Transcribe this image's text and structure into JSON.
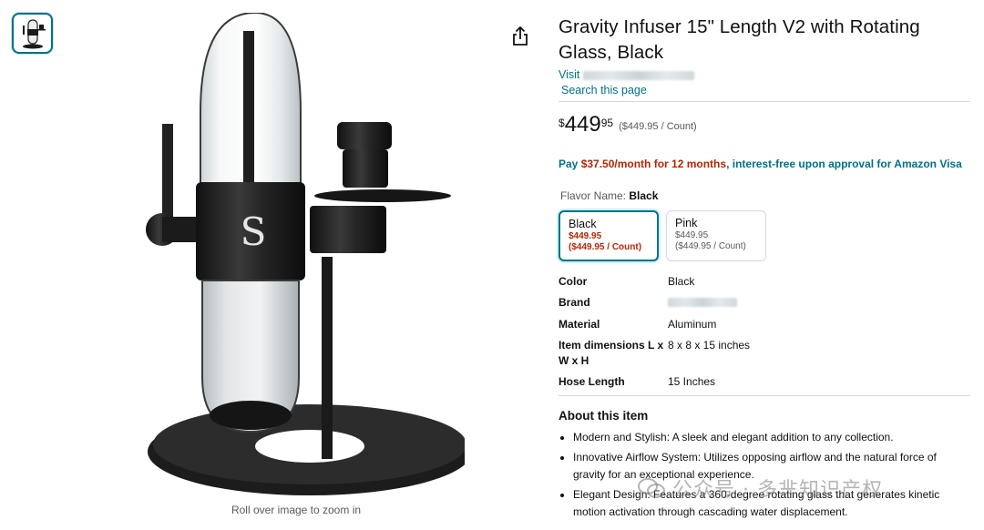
{
  "gallery": {
    "zoom_hint": "Roll over image to zoom in"
  },
  "product": {
    "title": "Gravity Infuser 15\" Length V2 with Rotating Glass, Black",
    "visit_prefix": "Visit",
    "search_page": "Search this page",
    "price": {
      "symbol": "$",
      "whole": "449",
      "fraction": "95",
      "per_unit": "($449.95 / Count)"
    },
    "financing": {
      "prefix": "Pay ",
      "amount": "$37.50/month for 12 months",
      "suffix": ", interest-free upon approval for Amazon Visa"
    },
    "flavor": {
      "label": "Flavor Name: ",
      "selected": "Black",
      "options": [
        {
          "name": "Black",
          "price": "$449.95",
          "unit": "($449.95 / Count)"
        },
        {
          "name": "Pink",
          "price": "$449.95",
          "unit": "($449.95 / Count)"
        }
      ]
    },
    "specs": [
      {
        "key": "Color",
        "value": "Black"
      },
      {
        "key": "Brand",
        "value": ""
      },
      {
        "key": "Material",
        "value": "Aluminum"
      },
      {
        "key": "Item dimensions L x W x H",
        "value": "8 x 8 x 15 inches"
      },
      {
        "key": "Hose Length",
        "value": "15 Inches"
      }
    ],
    "about_title": "About this item",
    "bullets": [
      "Modern and Stylish: A sleek and elegant addition to any collection.",
      "Innovative Airflow System: Utilizes opposing airflow and the natural force of gravity for an exceptional experience.",
      "Elegant Design: Features a 360-degree rotating glass that generates kinetic motion activation through cascading water displacement."
    ]
  },
  "watermark": {
    "text": "公众号 · 多芈知识产权"
  },
  "colors": {
    "link": "#007185",
    "price_red": "#b12704",
    "divider": "#d5d9d9"
  }
}
